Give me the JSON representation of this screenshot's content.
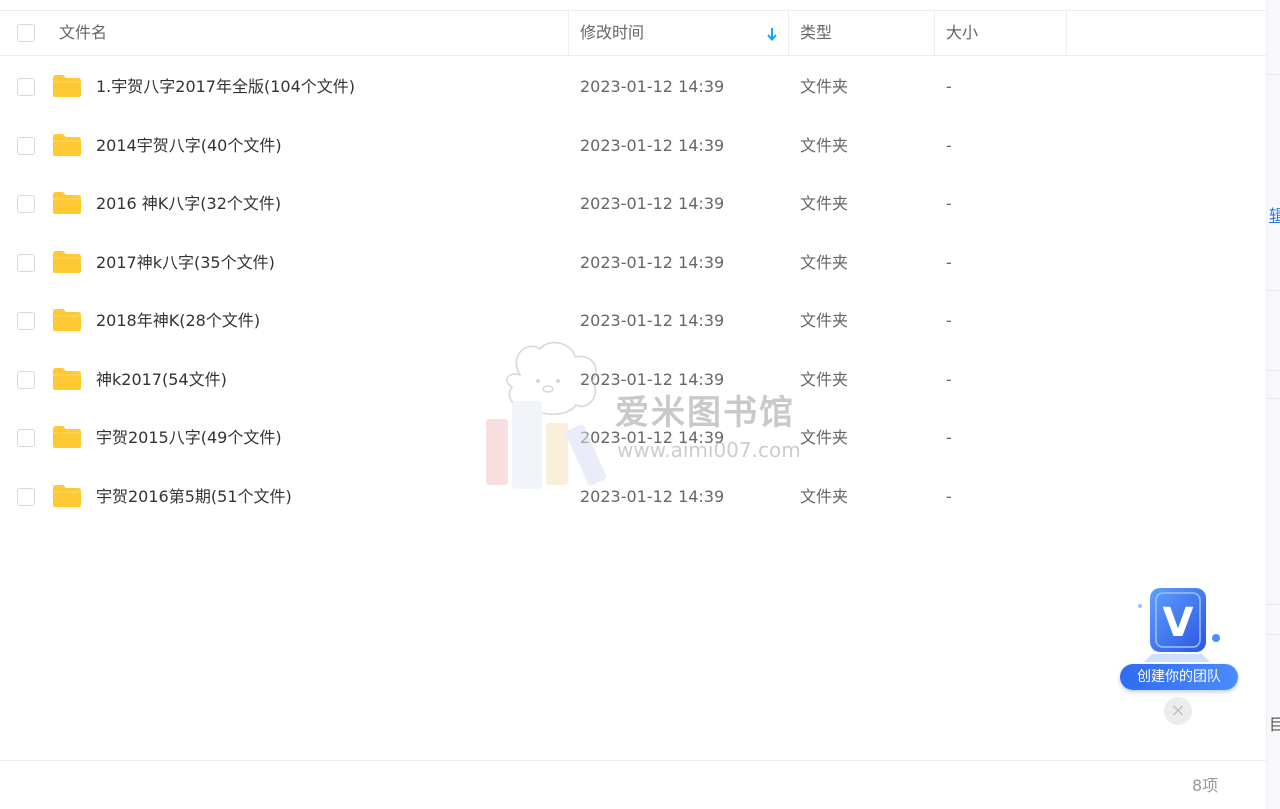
{
  "table": {
    "columns": {
      "name": "文件名",
      "mtime": "修改时间",
      "type": "类型",
      "size": "大小"
    },
    "sort": {
      "column": "mtime",
      "direction": "descending",
      "icon": "arrow-down-icon"
    },
    "rows": [
      {
        "name": "1.宇贺八字2017年全版(104个文件)",
        "mtime": "2023-01-12 14:39",
        "type": "文件夹",
        "size": "-"
      },
      {
        "name": "2014宇贺八字(40个文件)",
        "mtime": "2023-01-12 14:39",
        "type": "文件夹",
        "size": "-"
      },
      {
        "name": "2016 神K八字(32个文件)",
        "mtime": "2023-01-12 14:39",
        "type": "文件夹",
        "size": "-"
      },
      {
        "name": "2017神k八字(35个文件)",
        "mtime": "2023-01-12 14:39",
        "type": "文件夹",
        "size": "-"
      },
      {
        "name": "2018年神K(28个文件)",
        "mtime": "2023-01-12 14:39",
        "type": "文件夹",
        "size": "-"
      },
      {
        "name": "神k2017(54文件)",
        "mtime": "2023-01-12 14:39",
        "type": "文件夹",
        "size": "-"
      },
      {
        "name": "宇贺2015八字(49个文件)",
        "mtime": "2023-01-12 14:39",
        "type": "文件夹",
        "size": "-"
      },
      {
        "name": "宇贺2016第5期(51个文件)",
        "mtime": "2023-01-12 14:39",
        "type": "文件夹",
        "size": "-"
      }
    ]
  },
  "footer": {
    "count": "8项"
  },
  "watermark": {
    "title": "爱米图书馆",
    "url": "www.aimi007.com"
  },
  "promo": {
    "label": "创建你的团队",
    "badge_letter": "V",
    "close": "×"
  },
  "edge": {
    "glyph_link": "辑",
    "glyph_text": "目"
  },
  "colors": {
    "folder": "#ffc933",
    "accent": "#06a7ff",
    "promo_blue": "#2f6cf0"
  }
}
